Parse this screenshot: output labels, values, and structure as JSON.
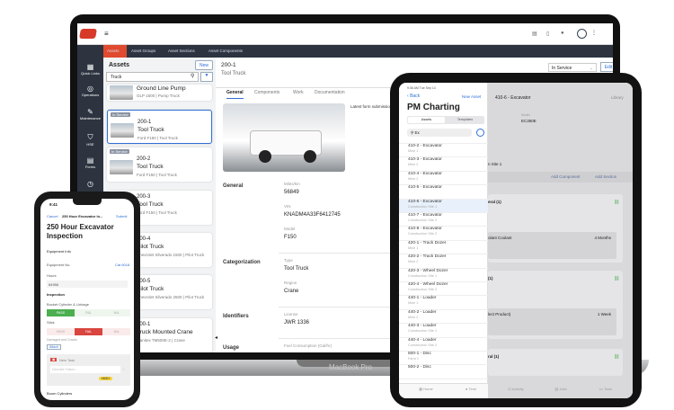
{
  "laptop": {
    "brand_label": "MacBook Pro",
    "nav_tabs": [
      "Assets",
      "Asset Groups",
      "Asset Sections",
      "Asset Components"
    ],
    "sidebar": [
      {
        "icon": "grid-icon",
        "label": "Quick Links"
      },
      {
        "icon": "operations-icon",
        "label": "Operations"
      },
      {
        "icon": "wrench-icon",
        "label": "Maintenance"
      },
      {
        "icon": "shield-icon",
        "label": "HSE"
      },
      {
        "icon": "form-icon",
        "label": "Forms"
      },
      {
        "icon": "clock-icon",
        "label": ""
      }
    ],
    "list": {
      "title": "Assets",
      "new_label": "New",
      "search_value": "Truck",
      "items": [
        {
          "badge": "",
          "id": "",
          "title": "Ground Line Pump",
          "sub": "GLP 1500 | Pump Truck"
        },
        {
          "badge": "In Service",
          "id": "200-1",
          "title": "Tool Truck",
          "sub": "Ford F150 | Tool Truck"
        },
        {
          "badge": "In Service",
          "id": "200-2",
          "title": "Tool Truck",
          "sub": "Ford F150 | Tool Truck"
        },
        {
          "badge": "",
          "id": "200-3",
          "title": "Tool Truck",
          "sub": "Ford F150 | Tool Truck"
        },
        {
          "badge": "",
          "id": "200-4",
          "title": "Pilot Truck",
          "sub": "Chevrolet Silverado 1500 | Pilot Truck"
        },
        {
          "badge": "",
          "id": "200-5",
          "title": "Pilot Truck",
          "sub": "Chevrolet Silverado 2500 | Pilot Truck"
        },
        {
          "badge": "",
          "id": "300-1",
          "title": "Truck Mounted Crane",
          "sub": "Manitex TM500E-2 | Crane"
        }
      ]
    },
    "detail": {
      "id": "200-1",
      "title": "Tool Truck",
      "status": "In Service",
      "edit_label": "Edit",
      "tabs": [
        "General",
        "Components",
        "Work",
        "Documentation"
      ],
      "latest_label": "Latest form submission",
      "sections": [
        {
          "name": "General",
          "fields": [
            {
              "label": "Miles/km",
              "value": "56849"
            },
            {
              "label": "VIN",
              "value": "KNADM4A33F6412745"
            },
            {
              "label": "Model",
              "value": "F150"
            }
          ]
        },
        {
          "name": "Categorization",
          "fields": [
            {
              "label": "Type",
              "value": "Tool Truck"
            },
            {
              "label": "Region",
              "value": "Crane"
            }
          ]
        },
        {
          "name": "Identifiers",
          "fields": [
            {
              "label": "License",
              "value": "JWR 1336"
            }
          ]
        },
        {
          "name": "Usage",
          "fields": [
            {
              "label": "Fuel Consumption (Gal/hr)",
              "value": ""
            }
          ]
        }
      ]
    }
  },
  "ipad": {
    "status_time": "9:36 AM  Tue Sep 14",
    "back_label": "Back",
    "new_asset_label": "New Asset",
    "title": "PM Charting",
    "segments": [
      "Assets",
      "Templates"
    ],
    "search_value": "Ex",
    "rows": [
      {
        "a": "410-2 - Excavator",
        "b": "Mine 1"
      },
      {
        "a": "410-3 - Excavator",
        "b": "Mine 2"
      },
      {
        "a": "410-4 - Excavator",
        "b": "Mine 2"
      },
      {
        "a": "410-5 - Excavator",
        "b": ""
      },
      {
        "a": "410-6 - Excavator",
        "b": "Construction Site 1"
      },
      {
        "a": "410-7 - Excavator",
        "b": "Construction Site 2"
      },
      {
        "a": "410-8 - Excavator",
        "b": "Construction Site 2"
      },
      {
        "a": "420-1 - Track Dozer",
        "b": "Mine 1"
      },
      {
        "a": "420-2 - Track Dozer",
        "b": "Mine 2"
      },
      {
        "a": "420-3 - Wheel Dozer",
        "b": "Construction Site 1"
      },
      {
        "a": "420-4 - Wheel Dozer",
        "b": "Construction Site 2"
      },
      {
        "a": "440-1 - Loader",
        "b": "Mine 1"
      },
      {
        "a": "440-2 - Loader",
        "b": "Mine 2"
      },
      {
        "a": "440-3 - Loader",
        "b": "Construction Site 1"
      },
      {
        "a": "440-4 - Loader",
        "b": "Construction Site 2"
      },
      {
        "a": "500-1 - Disc",
        "b": "Farm 1"
      },
      {
        "a": "500-2 - Disc",
        "b": ""
      }
    ],
    "right_title": "410-6 - Excavator",
    "library_label": "Library",
    "model_label": "Model",
    "model_value": "EC350E",
    "site": "n Site 1",
    "add_component": "Add Component",
    "add_section": "Add Section",
    "panels": [
      {
        "title": "eral (1)",
        "row": "olant  Coolant",
        "interval": "4 Months"
      },
      {
        "title": "(1)",
        "row": "lect Product)",
        "interval": "1 Week"
      },
      {
        "title": "ral (1)",
        "row": "",
        "interval": ""
      }
    ],
    "tabbar": [
      "Home",
      "Time",
      "Activity",
      "Jobs",
      "Tools"
    ]
  },
  "phone": {
    "time": "9:41",
    "cancel_label": "Cancel",
    "nav_title": "250 Hour Excavator In...",
    "submit_label": "Submit",
    "title": "250 Hour Excavator Inspection",
    "equip_section": "Equipment Info",
    "equip_no_label": "Equipment No.",
    "equip_no_action": "Cat 6018",
    "hours_label": "Hours",
    "hours_value": "84956",
    "inspection_label": "Inspection",
    "q1": "Bucket Cylinder & Linkage",
    "q2": "Stick",
    "options": [
      "PASS",
      "FAIL",
      "N/A"
    ],
    "comment_label": "Damaged and Cracks",
    "attach_label": "Attach",
    "task_label": "New Task",
    "task_placeholder": "Describe Failure...",
    "task_tag": "HIGH",
    "last_label": "Boom Cylinders"
  },
  "colors": {
    "accent": "#e04a2f",
    "nav": "#2d3440",
    "pass": "#4caf50",
    "fail": "#d9453f",
    "link": "#2f6fd6"
  }
}
